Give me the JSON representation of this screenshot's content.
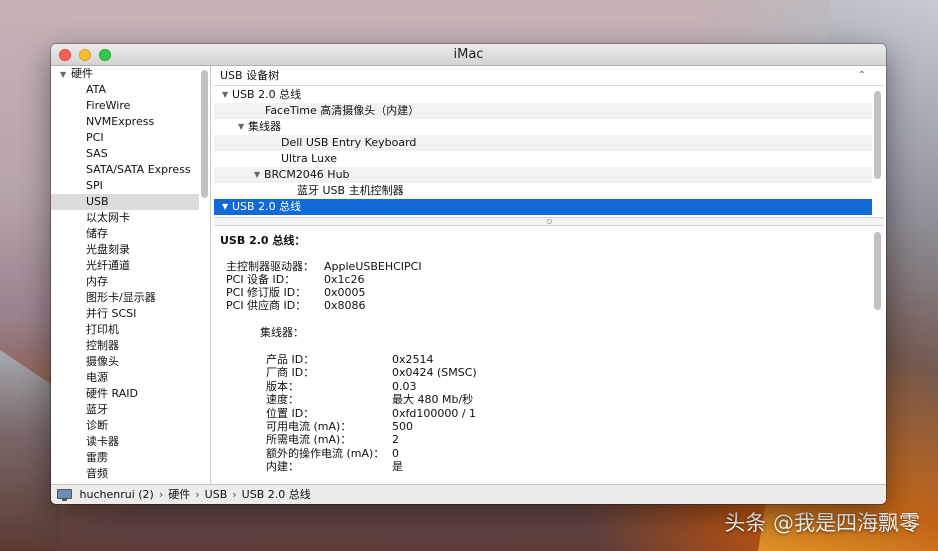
{
  "window": {
    "title": "iMac"
  },
  "sidebar": {
    "section_label": "硬件",
    "items": [
      {
        "label": "ATA"
      },
      {
        "label": "FireWire"
      },
      {
        "label": "NVMExpress"
      },
      {
        "label": "PCI"
      },
      {
        "label": "SAS"
      },
      {
        "label": "SATA/SATA Express"
      },
      {
        "label": "SPI"
      },
      {
        "label": "USB",
        "selected": true
      },
      {
        "label": "以太网卡"
      },
      {
        "label": "储存"
      },
      {
        "label": "光盘刻录"
      },
      {
        "label": "光纤通道"
      },
      {
        "label": "内存"
      },
      {
        "label": "图形卡/显示器"
      },
      {
        "label": "并行 SCSI"
      },
      {
        "label": "打印机"
      },
      {
        "label": "控制器"
      },
      {
        "label": "摄像头"
      },
      {
        "label": "电源"
      },
      {
        "label": "硬件 RAID"
      },
      {
        "label": "蓝牙"
      },
      {
        "label": "诊断"
      },
      {
        "label": "读卡器"
      },
      {
        "label": "雷雳"
      },
      {
        "label": "音频"
      }
    ]
  },
  "tree": {
    "header": "USB 设备树",
    "rows": [
      {
        "label": "USB 2.0 总线",
        "level": 0,
        "expanded": true
      },
      {
        "label": "FaceTime 高清摄像头（内建）",
        "level": 1
      },
      {
        "label": "集线器",
        "level": 1,
        "expanded": true
      },
      {
        "label": "Dell USB Entry Keyboard",
        "level": 2
      },
      {
        "label": "Ultra Luxe",
        "level": 2
      },
      {
        "label": "BRCM2046 Hub",
        "level": 2,
        "expanded": true
      },
      {
        "label": "蓝牙 USB 主机控制器",
        "level": 3
      },
      {
        "label": "USB 2.0 总线",
        "level": 0,
        "expanded": true,
        "selected": true
      }
    ]
  },
  "detail": {
    "title": "USB 2.0 总线：",
    "bus_props": [
      {
        "key": "主控制器驱动器：",
        "value": "AppleUSBEHCIPCI"
      },
      {
        "key": "PCI 设备 ID：",
        "value": "0x1c26"
      },
      {
        "key": "PCI 修订版 ID：",
        "value": "0x0005"
      },
      {
        "key": "PCI 供应商 ID：",
        "value": "0x8086"
      }
    ],
    "hub_title": "集线器：",
    "hub_props": [
      {
        "key": "产品 ID：",
        "value": "0x2514"
      },
      {
        "key": "厂商 ID：",
        "value": "0x0424  (SMSC)"
      },
      {
        "key": "版本：",
        "value": "0.03"
      },
      {
        "key": "速度：",
        "value": "最大 480 Mb/秒"
      },
      {
        "key": "位置 ID：",
        "value": "0xfd100000 / 1"
      },
      {
        "key": "可用电流 (mA)：",
        "value": "500"
      },
      {
        "key": "所需电流 (mA)：",
        "value": "2"
      },
      {
        "key": "额外的操作电流 (mA)：",
        "value": "0"
      },
      {
        "key": "内建：",
        "value": "是"
      }
    ]
  },
  "statusbar": {
    "icon": "imac-icon",
    "crumbs": [
      "huchenrui (2)",
      "硬件",
      "USB",
      "USB 2.0 总线"
    ]
  },
  "watermark": "头条 @我是四海飘零"
}
